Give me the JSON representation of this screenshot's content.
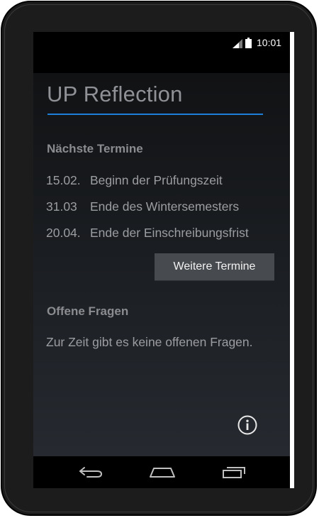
{
  "status_bar": {
    "time": "10:01",
    "icons": [
      "signal-icon",
      "battery-icon"
    ]
  },
  "app": {
    "title": "UP Reflection",
    "accent_color": "#1e7fd9",
    "upcoming": {
      "heading": "Nächste Termine",
      "items": [
        {
          "date": "15.02.",
          "label": "Beginn der Prüfungszeit"
        },
        {
          "date": "31.03",
          "label": "Ende des Wintersemesters"
        },
        {
          "date": "20.04.",
          "label": "Ende der Einschreibungsfrist"
        }
      ],
      "more_button": "Weitere Termine"
    },
    "questions": {
      "heading": "Offene Fragen",
      "empty_message": "Zur Zeit gibt es keine offenen Fragen."
    },
    "info_icon": "info-icon"
  },
  "nav_bar": {
    "icons": [
      "back-icon",
      "home-icon",
      "recent-apps-icon"
    ]
  }
}
